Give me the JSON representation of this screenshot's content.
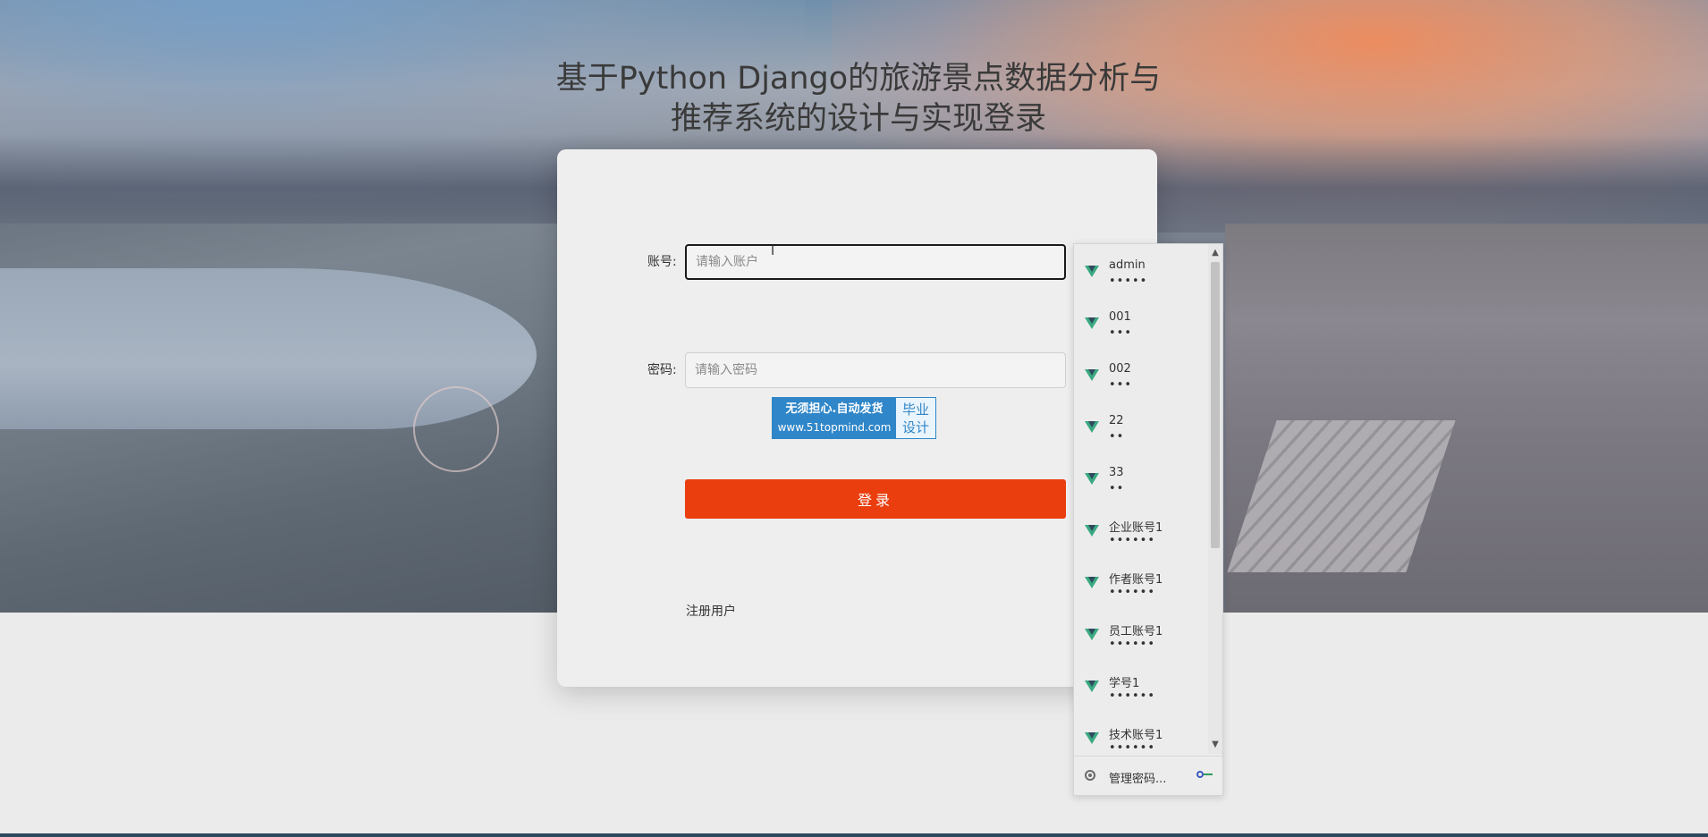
{
  "page": {
    "title": "基于Python Django的旅游景点数据分析与推荐系统的设计与实现登录"
  },
  "form": {
    "account_label": "账号:",
    "account_placeholder": "请输入账户",
    "password_label": "密码:",
    "password_placeholder": "请输入密码",
    "login_button": "登录",
    "register_link": "注册用户"
  },
  "badge": {
    "line1": "无须担心.自动发货",
    "line2": "www.51topmind.com",
    "right_line1": "毕业",
    "right_line2": "设计"
  },
  "password_popup": {
    "entries": [
      {
        "username": "admin",
        "masked": "•••••"
      },
      {
        "username": "001",
        "masked": "•••"
      },
      {
        "username": "002",
        "masked": "•••"
      },
      {
        "username": "22",
        "masked": "••"
      },
      {
        "username": "33",
        "masked": "••"
      },
      {
        "username": "企业账号1",
        "masked": "••••••"
      },
      {
        "username": "作者账号1",
        "masked": "••••••"
      },
      {
        "username": "员工账号1",
        "masked": "••••••"
      },
      {
        "username": "学号1",
        "masked": "••••••"
      },
      {
        "username": "技术账号1",
        "masked": "••••••"
      }
    ],
    "manage_label": "管理密码..."
  },
  "colors": {
    "login_button": "#ea3e0f",
    "badge_blue": "#2f86c8",
    "entry_icon_green": "#3aa981"
  },
  "icons": {
    "entry_icon": "vue-logo-icon",
    "manage_icon": "chrome-icon",
    "key_icon": "key-icon"
  }
}
